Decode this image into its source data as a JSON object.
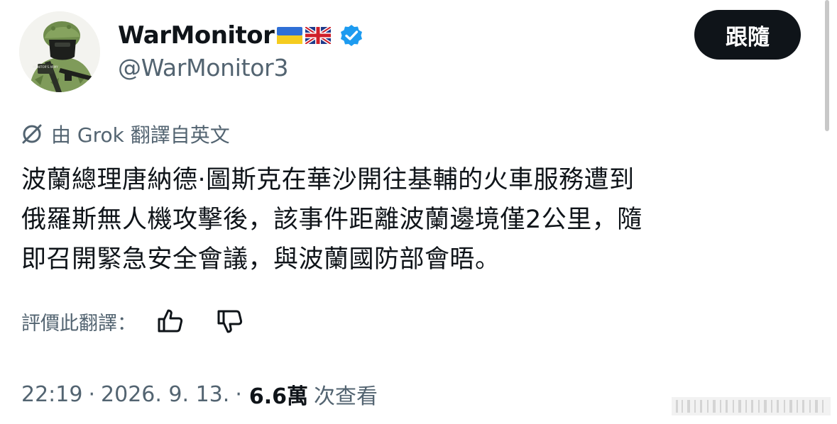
{
  "user": {
    "display_name": "WarMonitor",
    "flags": [
      "ukraine-flag-icon",
      "uk-flag-icon"
    ],
    "verified": true,
    "handle": "@WarMonitor3",
    "avatar_badge_text": "MONITOR'S ARMY"
  },
  "actions": {
    "follow_label": "跟隨"
  },
  "translation": {
    "label": "由 Grok 翻譯自英文",
    "icon": "grok-icon"
  },
  "tweet": {
    "lines": [
      "波蘭總理唐納德·圖斯克在華沙開往基輔的火車服務遭到",
      "俄羅斯無人機攻擊後，該事件距離波蘭邊境僅2公里，隨",
      "即召開緊急安全會議，與波蘭國防部會晤。"
    ]
  },
  "rating": {
    "label": "評價此翻譯：",
    "up_icon": "thumbs-up-icon",
    "down_icon": "thumbs-down-icon"
  },
  "meta": {
    "time": "22:19",
    "separator": "·",
    "date": "2026. 9. 13.",
    "views_count": "6.6萬",
    "views_label": "次查看"
  },
  "colors": {
    "text_primary": "#0f1419",
    "text_secondary": "#536471",
    "verified_blue": "#1d9bf0",
    "button_bg": "#0f1419",
    "background": "#ffffff"
  }
}
